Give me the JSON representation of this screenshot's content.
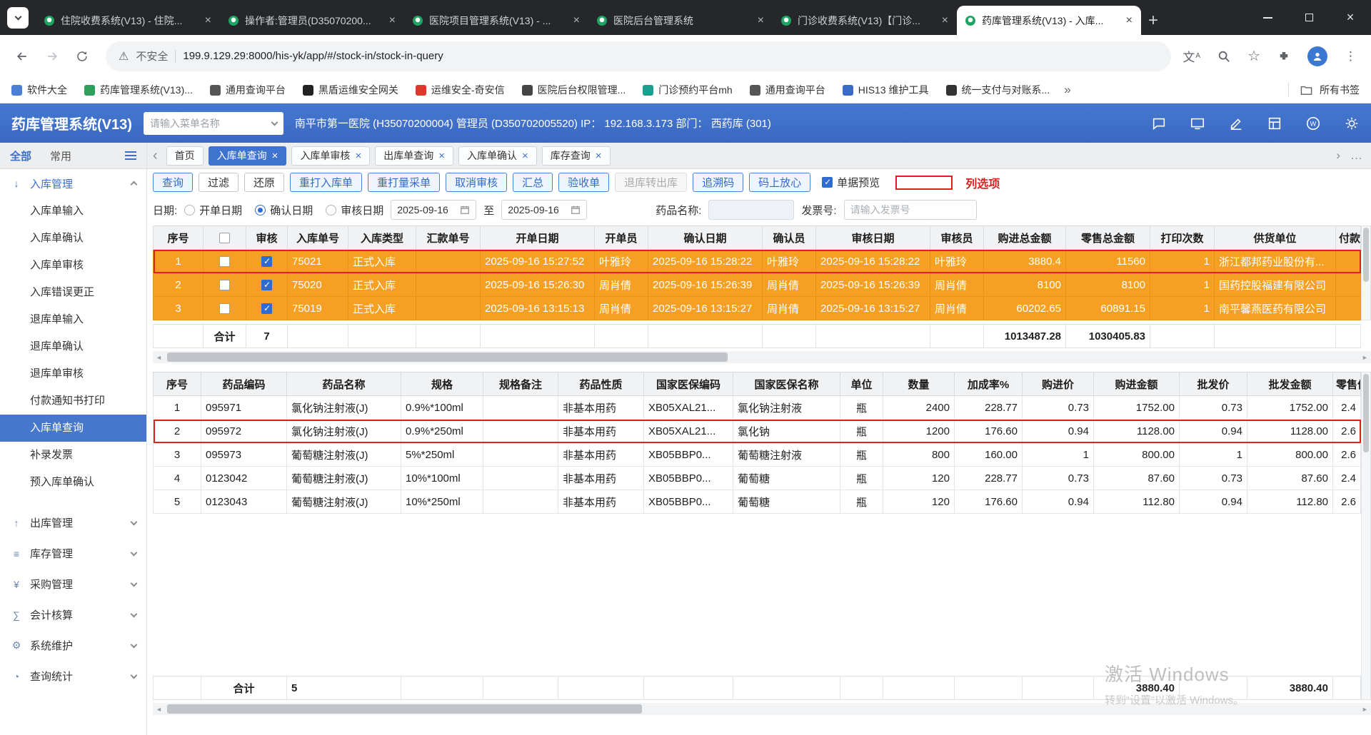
{
  "colors": {
    "accent_blue": "#3e6fc8",
    "selected_row_orange": "#f5a023",
    "annotation_red": "#e01f1f"
  },
  "browser": {
    "tabs": [
      {
        "title": "住院收费系统(V13) - 住院...",
        "state": ""
      },
      {
        "title": "操作者:管理员(D35070200...",
        "state": ""
      },
      {
        "title": "医院项目管理系统(V13) - ...",
        "state": ""
      },
      {
        "title": "医院后台管理系统",
        "state": ""
      },
      {
        "title": "门诊收费系统(V13)【门诊...",
        "state": ""
      },
      {
        "title": "药库管理系统(V13) - 入库...",
        "state": "active"
      }
    ],
    "address": {
      "security_label": "不安全",
      "url": "199.9.129.29:8000/his-yk/app/#/stock-in/stock-in-query"
    },
    "bookmarks": [
      {
        "label": "软件大全",
        "color": "#4a7fd4"
      },
      {
        "label": "药库管理系统(V13)...",
        "color": "#2e9e5b"
      },
      {
        "label": "通用查询平台",
        "color": "#555555"
      },
      {
        "label": "黑盾运维安全网关",
        "color": "#222222"
      },
      {
        "label": "运维安全-奇安信",
        "color": "#d93a2b"
      },
      {
        "label": "医院后台权限管理...",
        "color": "#444444"
      },
      {
        "label": "门诊预约平台mh",
        "color": "#1a9e8f"
      },
      {
        "label": "通用查询平台",
        "color": "#555555"
      },
      {
        "label": "HIS13 维护工具",
        "color": "#3b6bc7"
      },
      {
        "label": "统一支付与对账系...",
        "color": "#333333"
      }
    ],
    "bookmarks_overflow": "»",
    "all_bookmarks_label": "所有书签"
  },
  "app": {
    "title": "药库管理系统(V13)",
    "menu_search_placeholder": "请输入菜单名称",
    "user_info": "南平市第一医院 (H35070200004) 管理员 (D350702005520) IP： 192.168.3.173 部门： 西药库 (301)"
  },
  "workspace_tabs": {
    "filter_all": "全部",
    "filter_common": "常用",
    "tabs": [
      {
        "label": "首页",
        "state": ""
      },
      {
        "label": "入库单查询",
        "close": "×",
        "state": "active"
      },
      {
        "label": "入库单审核",
        "close": "×",
        "state": ""
      },
      {
        "label": "出库单查询",
        "close": "×",
        "state": ""
      },
      {
        "label": "入库单确认",
        "close": "×",
        "state": ""
      },
      {
        "label": "库存查询",
        "close": "×",
        "state": ""
      }
    ]
  },
  "sidebar": {
    "expanded_section": {
      "label": "入库管理",
      "glyph": "↓"
    },
    "items": [
      {
        "label": "入库单输入",
        "state": ""
      },
      {
        "label": "入库单确认",
        "state": ""
      },
      {
        "label": "入库单审核",
        "state": ""
      },
      {
        "label": "入库错误更正",
        "state": ""
      },
      {
        "label": "退库单输入",
        "state": ""
      },
      {
        "label": "退库单确认",
        "state": ""
      },
      {
        "label": "退库单审核",
        "state": ""
      },
      {
        "label": "付款通知书打印",
        "state": ""
      },
      {
        "label": "入库单查询",
        "state": "active"
      },
      {
        "label": "补录发票",
        "state": ""
      },
      {
        "label": "预入库单确认",
        "state": ""
      }
    ],
    "collapsed_sections": [
      {
        "label": "出库管理",
        "glyph": "↑"
      },
      {
        "label": "库存管理",
        "glyph": "≡"
      },
      {
        "label": "采购管理",
        "glyph": "¥"
      },
      {
        "label": "会计核算",
        "glyph": "∑"
      },
      {
        "label": "系统维护",
        "glyph": "⚙"
      },
      {
        "label": "查询统计",
        "glyph": "◔"
      }
    ]
  },
  "toolbar": {
    "buttons": [
      {
        "label": "查询",
        "style": "primary"
      },
      {
        "label": "过滤",
        "style": "plain"
      },
      {
        "label": "还原",
        "style": "plain"
      },
      {
        "label": "重打入库单",
        "style": "primary"
      },
      {
        "label": "重打量采单",
        "style": "primary"
      },
      {
        "label": "取消审核",
        "style": "primary"
      },
      {
        "label": "汇总",
        "style": "primary"
      },
      {
        "label": "验收单",
        "style": "primary"
      },
      {
        "label": "退库转出库",
        "style": "disabled"
      },
      {
        "label": "追溯码",
        "style": "primary"
      },
      {
        "label": "码上放心",
        "style": "primary"
      }
    ],
    "preview_label": "单据预览",
    "annotation_label": "列选项"
  },
  "filters": {
    "date_label": "日期:",
    "date_options": [
      {
        "label": "开单日期",
        "state": ""
      },
      {
        "label": "确认日期",
        "state": "checked"
      },
      {
        "label": "审核日期",
        "state": ""
      }
    ],
    "date_from": "2025-09-16",
    "range_separator": "至",
    "date_to": "2025-09-16",
    "drug_name_label": "药品名称:",
    "invoice_label": "发票号:",
    "invoice_placeholder": "请输入发票号"
  },
  "master_table": {
    "headers": [
      "序号",
      "",
      "审核",
      "入库单号",
      "入库类型",
      "汇款单号",
      "开单日期",
      "开单员",
      "确认日期",
      "确认员",
      "审核日期",
      "审核员",
      "购进总金额",
      "零售总金额",
      "打印次数",
      "供货单位",
      "付款"
    ],
    "rows": [
      {
        "seq": "1",
        "audit": "checked",
        "order_no": "75021",
        "type": "正式入库",
        "remit_no": "",
        "open_date": "2025-09-16 15:27:52",
        "open_by": "叶雅玲",
        "confirm_date": "2025-09-16 15:28:22",
        "confirm_by": "叶雅玲",
        "audit_date": "2025-09-16 15:28:22",
        "audit_by": "叶雅玲",
        "purchase_total": "3880.4",
        "retail_total": "11560",
        "print_count": "1",
        "supplier": "浙江都邦药业股份有...",
        "payment": "",
        "state": "selected current"
      },
      {
        "seq": "2",
        "audit": "checked",
        "order_no": "75020",
        "type": "正式入库",
        "remit_no": "",
        "open_date": "2025-09-16 15:26:30",
        "open_by": "周肖倩",
        "confirm_date": "2025-09-16 15:26:39",
        "confirm_by": "周肖倩",
        "audit_date": "2025-09-16 15:26:39",
        "audit_by": "周肖倩",
        "purchase_total": "8100",
        "retail_total": "8100",
        "print_count": "1",
        "supplier": "国药控股福建有限公司",
        "payment": "",
        "state": "selected"
      },
      {
        "seq": "3",
        "audit": "checked",
        "order_no": "75019",
        "type": "正式入库",
        "remit_no": "",
        "open_date": "2025-09-16 13:15:13",
        "open_by": "周肖倩",
        "confirm_date": "2025-09-16 13:15:27",
        "confirm_by": "周肖倩",
        "audit_date": "2025-09-16 13:15:27",
        "audit_by": "周肖倩",
        "purchase_total": "60202.65",
        "retail_total": "60891.15",
        "print_count": "1",
        "supplier": "南平馨燕医药有限公司",
        "payment": "",
        "state": "selected"
      }
    ],
    "totals": {
      "label": "合计",
      "count": "7",
      "purchase_total": "1013487.28",
      "retail_total": "1030405.83"
    }
  },
  "detail_table": {
    "headers": [
      "序号",
      "药品编码",
      "药品名称",
      "规格",
      "规格备注",
      "药品性质",
      "国家医保编码",
      "国家医保名称",
      "单位",
      "数量",
      "加成率%",
      "购进价",
      "购进金额",
      "批发价",
      "批发金额",
      "零售价"
    ],
    "rows": [
      {
        "seq": "1",
        "code": "095971",
        "name": "氯化钠注射液(J)",
        "spec": "0.9%*100ml",
        "spec_note": "",
        "nature": "非基本用药",
        "nhsa_code": "XB05XAL21...",
        "nhsa_name": "氯化钠注射液",
        "unit": "瓶",
        "qty": "2400",
        "markup": "228.77",
        "purchase_price": "0.73",
        "purchase_amount": "1752.00",
        "wholesale_price": "0.73",
        "wholesale_amount": "1752.00",
        "retail_price": "2.4",
        "state": ""
      },
      {
        "seq": "2",
        "code": "095972",
        "name": "氯化钠注射液(J)",
        "spec": "0.9%*250ml",
        "spec_note": "",
        "nature": "非基本用药",
        "nhsa_code": "XB05XAL21...",
        "nhsa_name": "氯化钠",
        "unit": "瓶",
        "qty": "1200",
        "markup": "176.60",
        "purchase_price": "0.94",
        "purchase_amount": "1128.00",
        "wholesale_price": "0.94",
        "wholesale_amount": "1128.00",
        "retail_price": "2.6",
        "state": "current"
      },
      {
        "seq": "3",
        "code": "095973",
        "name": "葡萄糖注射液(J)",
        "spec": "5%*250ml",
        "spec_note": "",
        "nature": "非基本用药",
        "nhsa_code": "XB05BBP0...",
        "nhsa_name": "葡萄糖注射液",
        "unit": "瓶",
        "qty": "800",
        "markup": "160.00",
        "purchase_price": "1",
        "purchase_amount": "800.00",
        "wholesale_price": "1",
        "wholesale_amount": "800.00",
        "retail_price": "2.6",
        "state": ""
      },
      {
        "seq": "4",
        "code": "0123042",
        "name": "葡萄糖注射液(J)",
        "spec": "10%*100ml",
        "spec_note": "",
        "nature": "非基本用药",
        "nhsa_code": "XB05BBP0...",
        "nhsa_name": "葡萄糖",
        "unit": "瓶",
        "qty": "120",
        "markup": "228.77",
        "purchase_price": "0.73",
        "purchase_amount": "87.60",
        "wholesale_price": "0.73",
        "wholesale_amount": "87.60",
        "retail_price": "2.4",
        "state": ""
      },
      {
        "seq": "5",
        "code": "0123043",
        "name": "葡萄糖注射液(J)",
        "spec": "10%*250ml",
        "spec_note": "",
        "nature": "非基本用药",
        "nhsa_code": "XB05BBP0...",
        "nhsa_name": "葡萄糖",
        "unit": "瓶",
        "qty": "120",
        "markup": "176.60",
        "purchase_price": "0.94",
        "purchase_amount": "112.80",
        "wholesale_price": "0.94",
        "wholesale_amount": "112.80",
        "retail_price": "2.6",
        "state": ""
      }
    ],
    "totals": {
      "label": "合计",
      "count": "5",
      "purchase_amount": "3880.40",
      "wholesale_amount": "3880.40"
    }
  },
  "watermark": {
    "line1": "激活 Windows",
    "line2": "转到“设置”以激活 Windows。"
  }
}
